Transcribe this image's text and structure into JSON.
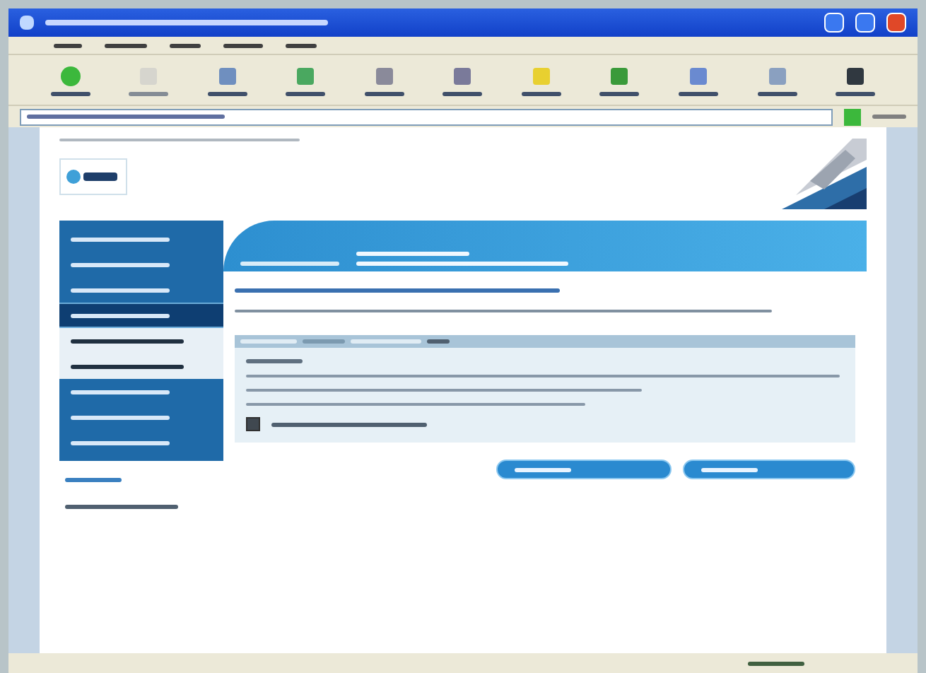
{
  "toolbar": {
    "buttons": [
      {
        "kind": "back",
        "disabled": false
      },
      {
        "kind": "forward",
        "disabled": true
      },
      {
        "kind": "page",
        "disabled": false
      },
      {
        "kind": "refresh",
        "disabled": false
      },
      {
        "kind": "home",
        "disabled": false
      },
      {
        "kind": "search",
        "disabled": false
      },
      {
        "kind": "star",
        "disabled": false
      },
      {
        "kind": "history",
        "disabled": false
      },
      {
        "kind": "mail",
        "disabled": false
      },
      {
        "kind": "print",
        "disabled": false
      },
      {
        "kind": "edit",
        "disabled": false
      }
    ]
  },
  "sidebar": {
    "items": [
      {
        "kind": "main",
        "selected": false
      },
      {
        "kind": "main",
        "selected": false
      },
      {
        "kind": "main",
        "selected": false
      },
      {
        "kind": "main",
        "selected": true
      },
      {
        "kind": "sub",
        "selected": false
      },
      {
        "kind": "sub",
        "selected": false
      },
      {
        "kind": "main",
        "selected": false
      },
      {
        "kind": "main",
        "selected": false
      },
      {
        "kind": "main",
        "selected": false
      }
    ]
  },
  "form": {
    "agree": {
      "checked": true
    }
  },
  "buttons": [
    {
      "kind": "pill"
    },
    {
      "kind": "pill"
    }
  ]
}
